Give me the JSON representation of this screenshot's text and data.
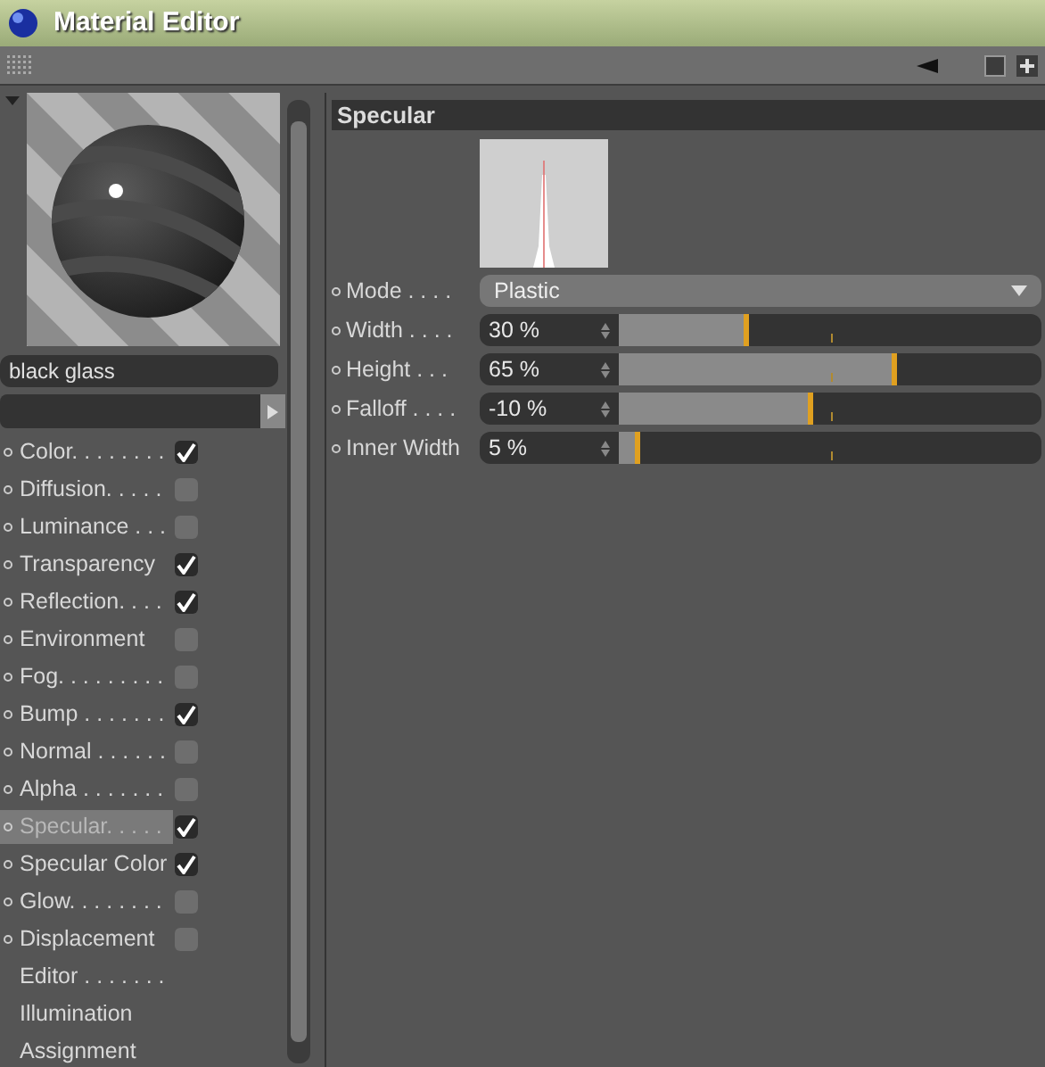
{
  "window": {
    "title": "Material Editor"
  },
  "material": {
    "name": "black glass"
  },
  "channels": [
    {
      "label": "Color. . . . . . . .",
      "kind": "check",
      "checked": true,
      "selected": false
    },
    {
      "label": "Diffusion. . . . .",
      "kind": "check",
      "checked": false,
      "selected": false
    },
    {
      "label": "Luminance . . .",
      "kind": "check",
      "checked": false,
      "selected": false
    },
    {
      "label": "Transparency",
      "kind": "check",
      "checked": true,
      "selected": false
    },
    {
      "label": "Reflection. . . .",
      "kind": "check",
      "checked": true,
      "selected": false
    },
    {
      "label": "Environment",
      "kind": "check",
      "checked": false,
      "selected": false
    },
    {
      "label": "Fog. . . . . . . . .",
      "kind": "check",
      "checked": false,
      "selected": false
    },
    {
      "label": "Bump . . . . . . .",
      "kind": "check",
      "checked": true,
      "selected": false
    },
    {
      "label": "Normal . . . . . .",
      "kind": "check",
      "checked": false,
      "selected": false
    },
    {
      "label": "Alpha . . . . . . .",
      "kind": "check",
      "checked": false,
      "selected": false
    },
    {
      "label": "Specular. . . . .",
      "kind": "check",
      "checked": true,
      "selected": true
    },
    {
      "label": "Specular Color",
      "kind": "check",
      "checked": true,
      "selected": false
    },
    {
      "label": "Glow. . . . . . . .",
      "kind": "check",
      "checked": false,
      "selected": false
    },
    {
      "label": "Displacement",
      "kind": "check",
      "checked": false,
      "selected": false
    },
    {
      "label": "Editor . . . . . . .",
      "kind": "plain",
      "selected": false
    },
    {
      "label": "Illumination",
      "kind": "plain",
      "selected": false
    },
    {
      "label": "Assignment",
      "kind": "plain",
      "selected": false
    }
  ],
  "section": {
    "title": "Specular",
    "params": [
      {
        "label": "Mode . . . .",
        "kind": "dropdown",
        "value": "Plastic"
      },
      {
        "label": "Width . . . .",
        "kind": "slider",
        "value": "30 %",
        "level": 0.31
      },
      {
        "label": "Height . . .",
        "kind": "slider",
        "value": "65 %",
        "level": 0.66
      },
      {
        "label": "Falloff . . . .",
        "kind": "slider",
        "value": "-10 %",
        "level": 0.46
      },
      {
        "label": "Inner Width",
        "kind": "slider",
        "value": "5 %",
        "level": 0.05
      }
    ]
  }
}
